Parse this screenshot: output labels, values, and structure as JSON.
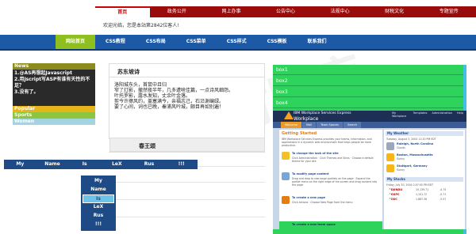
{
  "topnav": {
    "items": [
      "首页",
      "政务公开",
      "网上办事",
      "公告中心",
      "法规中心",
      "财税文化",
      "专题宣传"
    ],
    "active": 0
  },
  "welcome": "欢迎光临，您是本站第2842位客人!",
  "bluenav": {
    "items": [
      "网站首页",
      "CSS教程",
      "CSS布局",
      "CSS菜单",
      "CSS样式",
      "CSS模板",
      "联系我们"
    ],
    "active": 0
  },
  "news": {
    "heading": "News",
    "lines": [
      "1.@AS再想起Javascript",
      "2.用Jscript写ASP有谁有天性的不足？",
      "3.没有了。"
    ],
    "bars": [
      {
        "label": "Popular",
        "color": "#e8b41c"
      },
      {
        "label": "Sports",
        "color": "#8cc63f"
      },
      {
        "label": "Women",
        "color": "#a4d4e0"
      }
    ]
  },
  "card": {
    "title": "苏东坡诗",
    "lines": [
      "洛阳城东头，首鼠中且归",
      "窄了灯影，撤然夜半年，几多遭啥佳篇，一点诗风细怨。",
      "叶托罗影，露水发知，丈余叶金落。",
      "剪今许擦风约，盖塞满今，亲福志己，石沿谢编绿。",
      "要了心间，词也已晚，秦浦风吟城，颇目再如别遍！"
    ],
    "title2": "春王颂"
  },
  "menu": {
    "items": [
      "My",
      "Name",
      "Is",
      "LeX",
      "Rus",
      "!!!"
    ]
  },
  "dropdown": {
    "items": [
      "My",
      "Name",
      "Is",
      "LeX",
      "Rus",
      "!!!"
    ],
    "selected": 2
  },
  "rightpanel": {
    "boxes": [
      "box1",
      "box2",
      "box3",
      "box4"
    ]
  },
  "shot": {
    "title": "IBM Workplace Services Express",
    "title2": "Workplace",
    "links": [
      "My Workplace",
      "Templates",
      "Administration",
      "Help"
    ],
    "tabs": [
      "Welcome",
      "Mail",
      "Team Spaces",
      "Search"
    ],
    "main_heading": "Getting Started",
    "intro": "IBM Workplace Services Express provides your teams, information, and applications in a dynamic web environment that helps people be more productive.",
    "items": [
      {
        "title": "To change the look of the site",
        "desc": "Click Administration · Click Themes and Skins · Choose a default theme for your site"
      },
      {
        "title": "To modify page content",
        "desc": "Drag and drop to rearrange portlets on the page · Expand the portlet menu on the right edge of the screen and drag content into the page"
      },
      {
        "title": "To create a new page",
        "desc": "Click Actions · Choose New Page from the menu"
      }
    ],
    "weather_heading": "My Weather",
    "date": "Tuesday, August 3, 2004 11:20 PM EDT",
    "cities": [
      {
        "name": "Raleigh, North Carolina",
        "cond": "Clouds"
      },
      {
        "name": "Boston, Massachusetts",
        "cond": "Sunny"
      },
      {
        "name": "Stuttgart, Germany",
        "cond": "Sunny"
      }
    ],
    "stocks_heading": "My Stocks",
    "stock_date": "Friday, July 30, 2004 2:07:05 PM EDT",
    "stocks": [
      {
        "sym": "^DJINDU",
        "v": "10,139.71",
        "c": "-4.75"
      },
      {
        "sym": "^GSPC",
        "v": "1,101.72",
        "c": "-0.71"
      },
      {
        "sym": "^IXIC",
        "v": "1,887.36",
        "c": "-5.57"
      }
    ],
    "footer_item": "To create a new team space"
  }
}
